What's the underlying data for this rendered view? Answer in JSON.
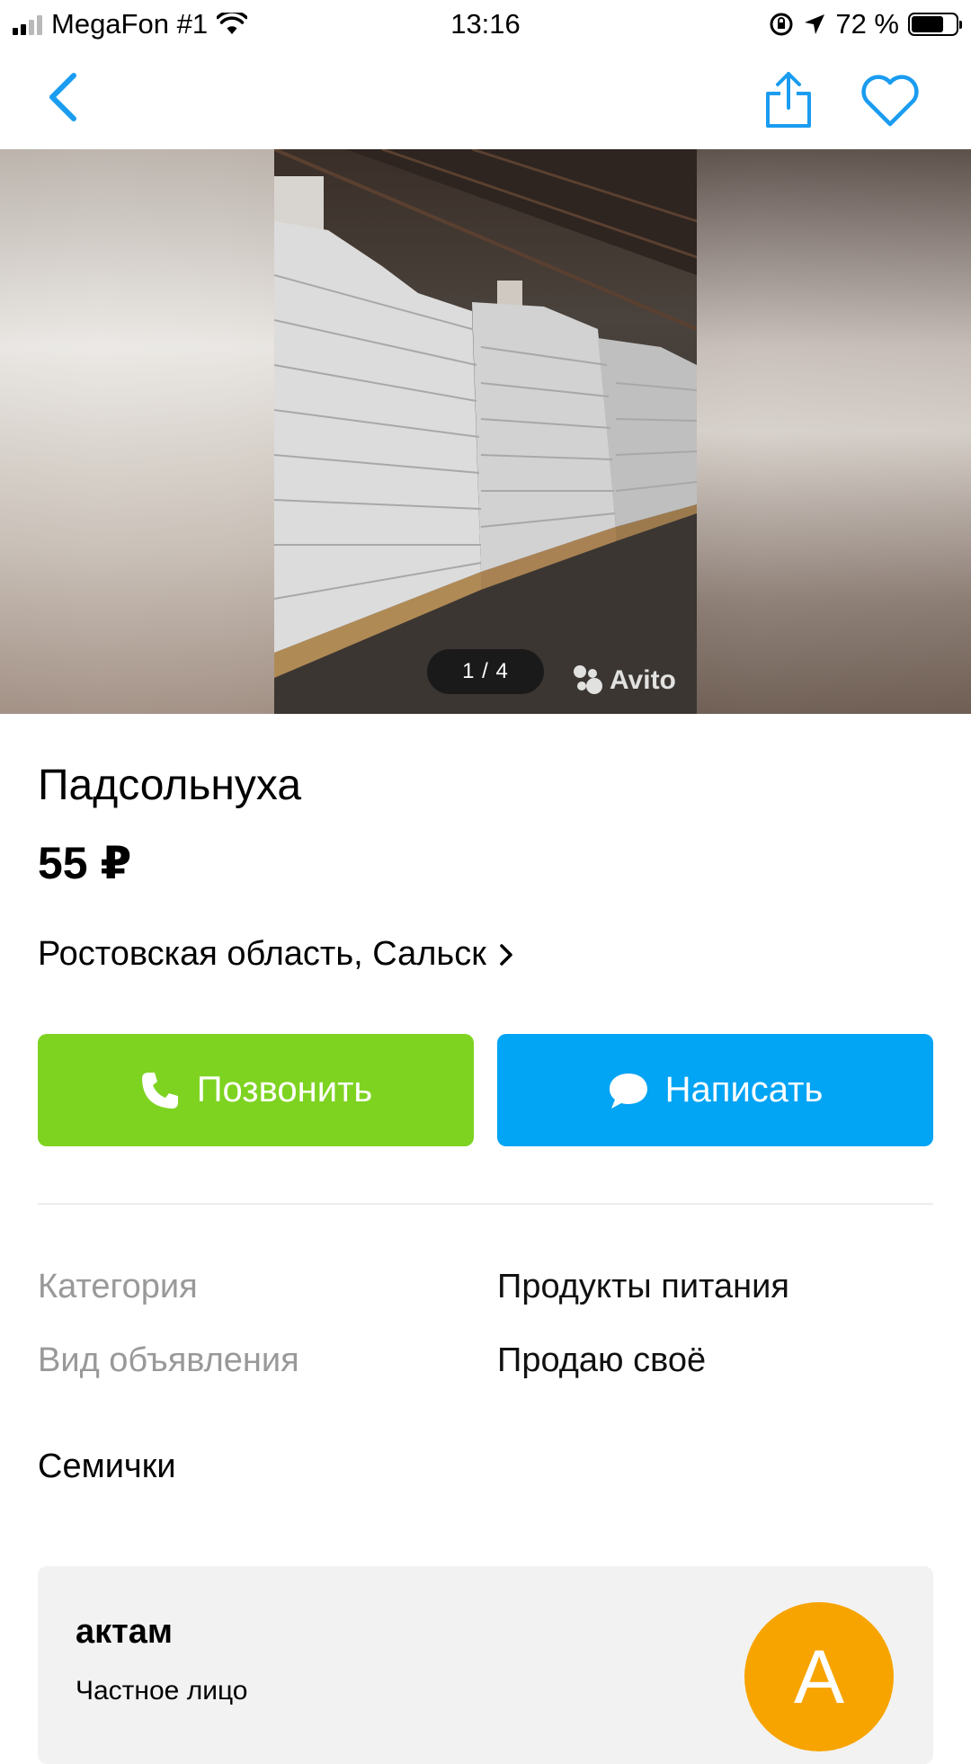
{
  "status_bar": {
    "carrier": "MegaFon #1",
    "time": "13:16",
    "battery": "72 %",
    "battery_level": 0.72
  },
  "nav": {
    "back_icon": "chevron-left-icon",
    "share_icon": "share-icon",
    "favorite_icon": "heart-icon",
    "accent_color": "#1a9cf0"
  },
  "gallery": {
    "counter": "1 / 4",
    "watermark": "Avito"
  },
  "listing": {
    "title": "Падсольнуха",
    "price": "55 ₽",
    "location": "Ростовская область, Сальск"
  },
  "actions": {
    "call_label": "Позвонить",
    "call_color": "#7ed321",
    "message_label": "Написать",
    "message_color": "#02a4f4"
  },
  "params": [
    {
      "label": "Категория",
      "value": "Продукты питания"
    },
    {
      "label": "Вид объявления",
      "value": "Продаю своё"
    }
  ],
  "description": "Семички",
  "seller": {
    "name": "актам",
    "type": "Частное лицо",
    "avatar_letter": "А",
    "avatar_color": "#f8a400"
  }
}
